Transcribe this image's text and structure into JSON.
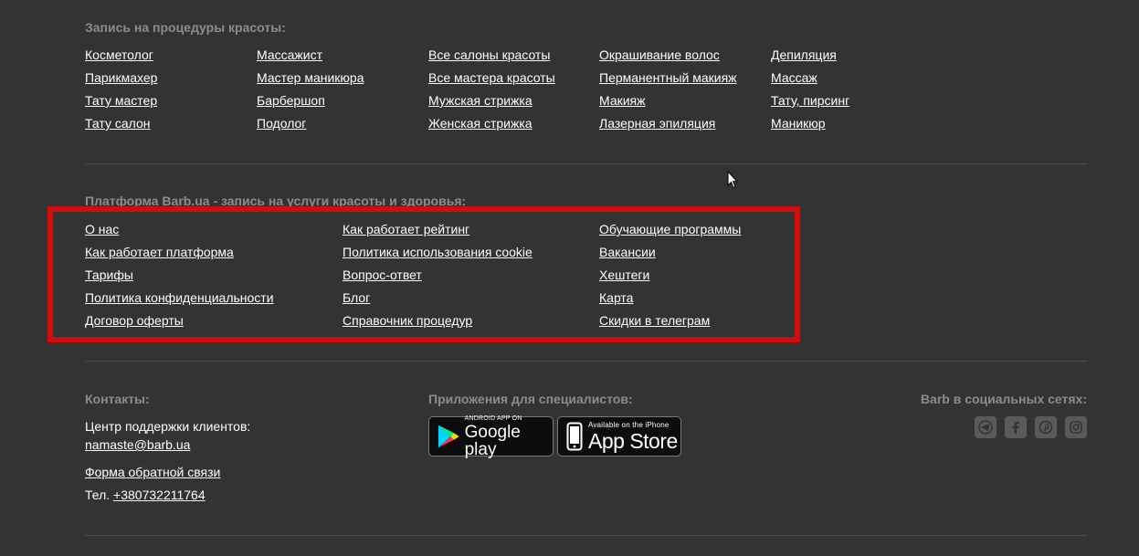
{
  "procedures": {
    "title": "Запись на процедуры красоты:",
    "columns": [
      [
        "Косметолог",
        "Парикмахер",
        "Тату мастер",
        "Тату салон"
      ],
      [
        "Массажист",
        "Мастер маникюра",
        "Барбершоп",
        "Подолог"
      ],
      [
        "Все салоны красоты",
        "Все мастера красоты",
        "Мужская стрижка",
        "Женская стрижка"
      ],
      [
        "Окрашивание волос",
        "Перманентный макияж",
        "Макияж",
        "Лазерная эпиляция"
      ],
      [
        "Депиляция",
        "Массаж",
        "Тату, пирсинг",
        "Маникюр"
      ]
    ]
  },
  "platform": {
    "title": "Платформа Barb.ua - запись на услуги красоты и здоровья:",
    "columns": [
      [
        "О нас",
        "Как работает платформа",
        "Тарифы",
        "Политика конфиденциальности",
        "Договор оферты"
      ],
      [
        "Как работает рейтинг",
        "Политика использования cookie",
        "Вопрос-ответ",
        "Блог",
        "Справочник процедур"
      ],
      [
        "Обучающие программы",
        "Вакансии",
        "Хештеги",
        "Карта",
        "Скидки в телеграм"
      ]
    ]
  },
  "contacts": {
    "title": "Контакты:",
    "support_label": "Центр поддержки клиентов:",
    "email": "namaste@barb.ua",
    "feedback_link": "Форма обратной связи",
    "phone_label": "Тел.",
    "phone": "+380732211764"
  },
  "apps": {
    "title": "Приложения для специалистов:",
    "google_small": "ANDROID APP ON",
    "google_big": "Google play",
    "apple_small": "Available on the iPhone",
    "apple_big": "App Store"
  },
  "social": {
    "title": "Barb в социальных сетях:",
    "icons": [
      "telegram-icon",
      "facebook-icon",
      "pinterest-icon",
      "instagram-icon"
    ]
  },
  "colors": {
    "background": "#333333",
    "highlight": "#d60c0c",
    "muted_title": "#8c8c8c"
  }
}
